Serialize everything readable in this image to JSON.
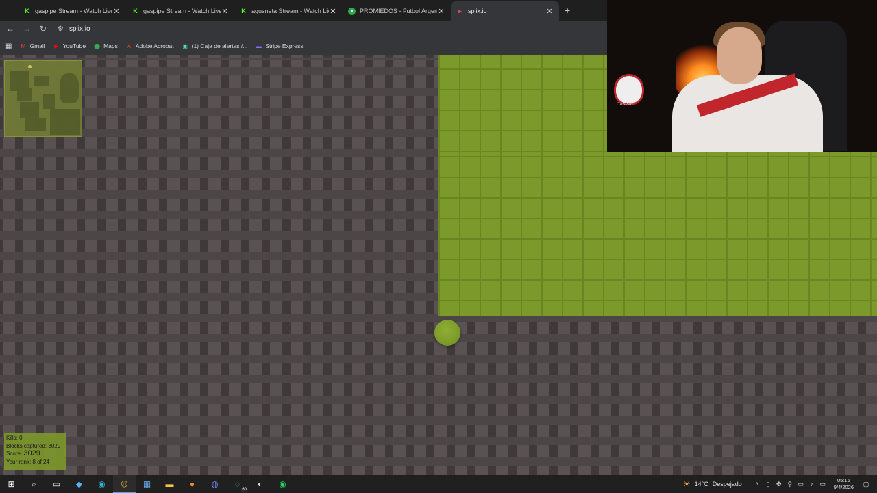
{
  "browser": {
    "tabs": [
      {
        "title": "gaspipe Stream - Watch Live on",
        "icon": "kick-icon",
        "active": false
      },
      {
        "title": "gaspipe Stream - Watch Live on",
        "icon": "kick-icon",
        "active": false
      },
      {
        "title": "agusneta Stream - Watch Live o",
        "icon": "kick-icon",
        "active": false
      },
      {
        "title": "PROMIEDOS - Futbol Argentino",
        "icon": "promiedos-icon",
        "active": false
      },
      {
        "title": "splix.io",
        "icon": "splix-icon",
        "active": true
      }
    ],
    "tab_close_symbol": "✕",
    "new_tab_symbol": "+",
    "address": "splix.io",
    "bookmarks": [
      {
        "label": "Gmail",
        "icon": "gmail-icon"
      },
      {
        "label": "YouTube",
        "icon": "youtube-icon"
      },
      {
        "label": "Maps",
        "icon": "maps-icon"
      },
      {
        "label": "Adobe Acrobat",
        "icon": "acrobat-icon"
      },
      {
        "label": "(1) Caja de alertas /...",
        "icon": "alerts-icon"
      },
      {
        "label": "Stripe Express",
        "icon": "stripe-icon"
      }
    ]
  },
  "game": {
    "stats": {
      "kills_label": "Kills:",
      "kills": "0",
      "blocks_label": "Blocks captured:",
      "blocks": "3029",
      "score_label": "Score:",
      "score": "3029",
      "rank_label": "Your rank:",
      "rank": "8 of 24"
    },
    "colors": {
      "territory": "#7c9a2b",
      "background": "#4d4646",
      "player": "#86a430"
    }
  },
  "webcam": {
    "badge_text": "CASPAR"
  },
  "taskbar": {
    "weather_temp": "14°C",
    "weather_text": "Despejado",
    "time": "05:16",
    "date": "9/4/2026",
    "whatsapp_badge": "60"
  }
}
